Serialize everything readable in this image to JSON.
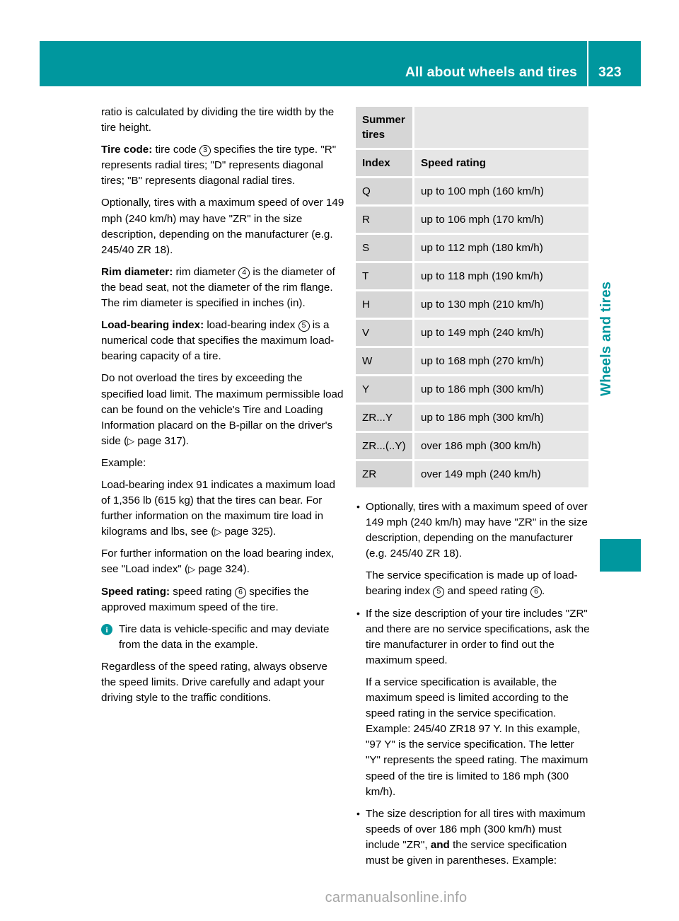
{
  "header": {
    "title": "All about wheels and tires",
    "page_number": "323"
  },
  "side_tab": {
    "label": "Wheels and tires"
  },
  "footer": {
    "watermark": "carmanualsonline.info"
  },
  "left_column": {
    "p1": "ratio is calculated by dividing the tire width by the tire height.",
    "p2_label": "Tire code:",
    "p2_a": " tire code ",
    "p2_ref": "3",
    "p2_b": " specifies the tire type. \"R\" represents radial tires; \"D\" represents diagonal tires; \"B\" represents diagonal radial tires.",
    "p3": "Optionally, tires with a maximum speed of over 149 mph (240 km/h) may have \"ZR\" in the size description, depending on the manufacturer (e.g. 245/40 ZR 18).",
    "p4_label": "Rim diameter:",
    "p4_a": " rim diameter ",
    "p4_ref": "4",
    "p4_b": " is the diameter of the bead seat, not the diameter of the rim flange. The rim diameter is specified in inches (in).",
    "p5_label": "Load-bearing index:",
    "p5_a": "  load-bearing index ",
    "p5_ref": "5",
    "p5_b": " is a numerical code that specifies the maximum load-bearing capacity of a tire.",
    "p6_a": "Do not overload the tires by exceeding the specified load limit. The maximum permissible load can be found on the vehicle's Tire and Loading Information placard on the B-pillar on the driver's side (",
    "p6_ref": "▷",
    "p6_b": " page 317).",
    "p7": "Example:",
    "p8_a": "Load-bearing index 91 indicates a maximum load of 1,356 lb (615 kg) that the tires can bear. For further information on the maximum tire load in kilograms and lbs, see (",
    "p8_ref": "▷",
    "p8_b": " page 325).",
    "p9_a": "For further information on the load bearing index, see \"Load index\" (",
    "p9_ref": "▷",
    "p9_b": " page 324).",
    "p10_label": "Speed rating:",
    "p10_a": " speed rating ",
    "p10_ref": "6",
    "p10_b": " specifies the approved maximum speed of the tire.",
    "note_icon": "info-icon",
    "note_text": "Tire data is vehicle-specific and may deviate from the data in the example.",
    "p11": "Regardless of the speed rating, always observe the speed limits. Drive carefully and adapt your driving style to the traffic conditions."
  },
  "speed_table": {
    "title": "Summer tires",
    "headers": [
      "Index",
      "Speed rating"
    ],
    "rows": [
      [
        "Q",
        "up to 100 mph (160 km/h)"
      ],
      [
        "R",
        "up to 106 mph (170 km/h)"
      ],
      [
        "S",
        "up to 112 mph (180 km/h)"
      ],
      [
        "T",
        "up to 118 mph (190 km/h)"
      ],
      [
        "H",
        "up to 130 mph (210 km/h)"
      ],
      [
        "V",
        "up to 149 mph (240 km/h)"
      ],
      [
        "W",
        "up to 168 mph (270 km/h)"
      ],
      [
        "Y",
        "up to 186 mph (300 km/h)"
      ],
      [
        "ZR...Y",
        "up to 186 mph (300 km/h)"
      ],
      [
        "ZR...(..Y)",
        "over 186 mph (300 km/h)"
      ],
      [
        "ZR",
        "over 149 mph (240 km/h)"
      ]
    ]
  },
  "right_column": {
    "b1_p1": "Optionally, tires with a maximum speed of over 149 mph (240 km/h) may have \"ZR\" in the size description, depending on the manufacturer (e.g. 245/40 ZR 18).",
    "b1_p2_a": "The service specification is made up of load-bearing index ",
    "b1_p2_ref1": "5",
    "b1_p2_b": " and speed rating ",
    "b1_p2_ref2": "6",
    "b1_p2_c": ".",
    "b2_p1": "If the size description of your tire includes \"ZR\" and there are no service specifications, ask the tire manufacturer in order to find out the maximum speed.",
    "b2_p2": "If a service specification is available, the maximum speed is limited according to the speed rating in the service specification. Example: 245/40 ZR18 97 Y. In this example, \"97 Y\" is the service specification. The letter \"Y\" represents the speed rating. The maximum speed of the tire is limited to 186 mph (300 km/h).",
    "b3_a": "The size description for all tires with maximum speeds of over 186 mph (300 km/h) must include \"ZR\", ",
    "b3_bold": "and",
    "b3_b": " the service specification must be given in parentheses. Example:"
  },
  "colors": {
    "brand_teal": "#00979e",
    "table_index_bg": "#d6d6d6",
    "table_value_bg": "#e6e6e6",
    "watermark_gray": "#a6a6a6"
  }
}
